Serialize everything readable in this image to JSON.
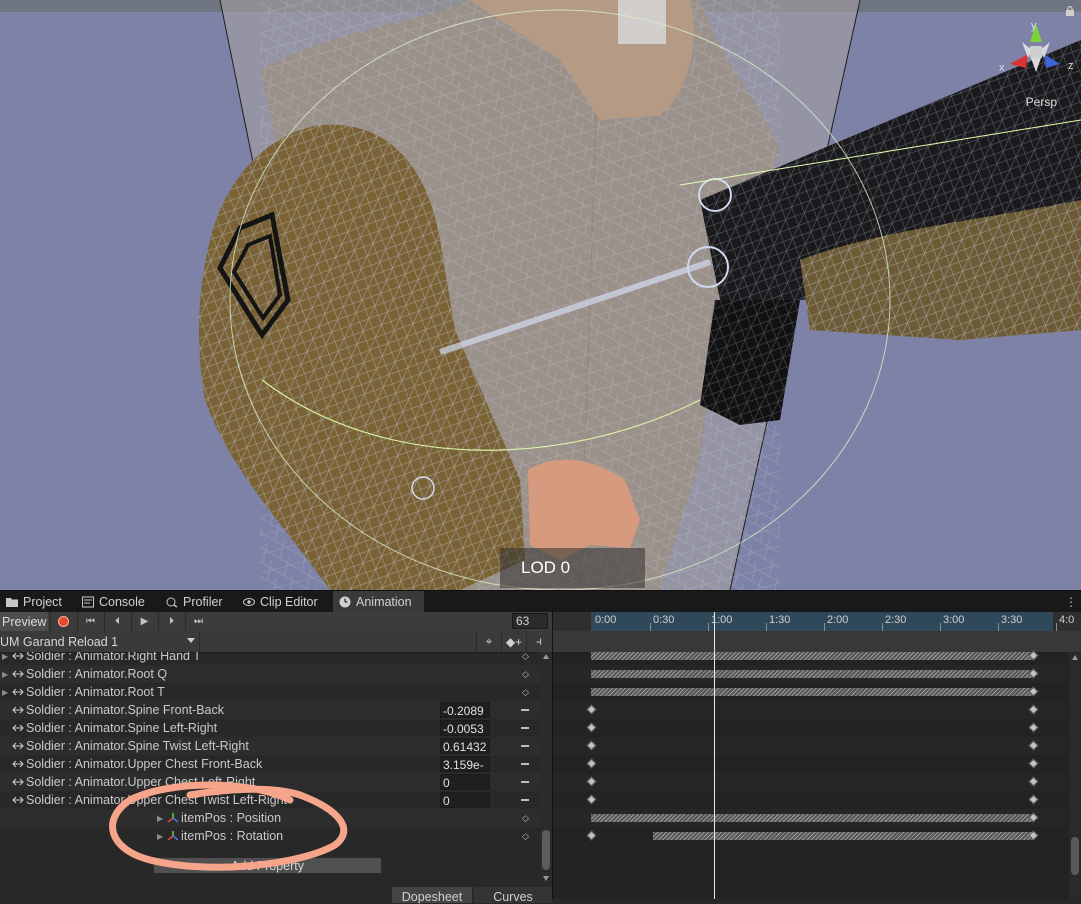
{
  "scene": {
    "lod_label": "LOD 0",
    "view_mode": "Persp",
    "gizmo": {
      "y": "y",
      "x": "x",
      "z": "z"
    }
  },
  "tabs": [
    {
      "label": "Project",
      "icon": "folder-icon"
    },
    {
      "label": "Console",
      "icon": "console-icon"
    },
    {
      "label": "Profiler",
      "icon": "profiler-icon"
    },
    {
      "label": "Clip Editor",
      "icon": "eye-icon"
    },
    {
      "label": "Animation",
      "icon": "animation-clock-icon",
      "active": true
    }
  ],
  "animation": {
    "preview_label": "Preview",
    "frame": "63",
    "clip_name": "UM Garand Reload 1",
    "add_property_label": "Add Property",
    "bottom_tabs": {
      "dopesheet": "Dopesheet",
      "curves": "Curves"
    },
    "properties": [
      {
        "name": "Soldier : Animator.Right Hand T",
        "expandable": true,
        "value": ""
      },
      {
        "name": "Soldier : Animator.Root Q",
        "expandable": true,
        "value": ""
      },
      {
        "name": "Soldier : Animator.Root T",
        "expandable": true,
        "value": ""
      },
      {
        "name": "Soldier : Animator.Spine Front-Back",
        "expandable": false,
        "value": "-0.2089"
      },
      {
        "name": "Soldier : Animator.Spine Left-Right",
        "expandable": false,
        "value": "-0.0053"
      },
      {
        "name": "Soldier : Animator.Spine Twist Left-Right",
        "expandable": false,
        "value": "0.61432"
      },
      {
        "name": "Soldier : Animator.Upper Chest Front-Back",
        "expandable": false,
        "value": "3.159e-"
      },
      {
        "name": "Soldier : Animator.Upper Chest Left-Right",
        "expandable": false,
        "value": "0"
      },
      {
        "name": "Soldier : Animator.Upper Chest Twist Left-Right",
        "expandable": false,
        "value": "0"
      },
      {
        "name": "itemPos : Position",
        "expandable": true,
        "value": ""
      },
      {
        "name": "itemPos : Rotation",
        "expandable": true,
        "value": ""
      }
    ],
    "timeline_ticks": [
      "0:00",
      "0:30",
      "1:00",
      "1:30",
      "2:00",
      "2:30",
      "3:00",
      "3:30",
      "4:0"
    ]
  }
}
